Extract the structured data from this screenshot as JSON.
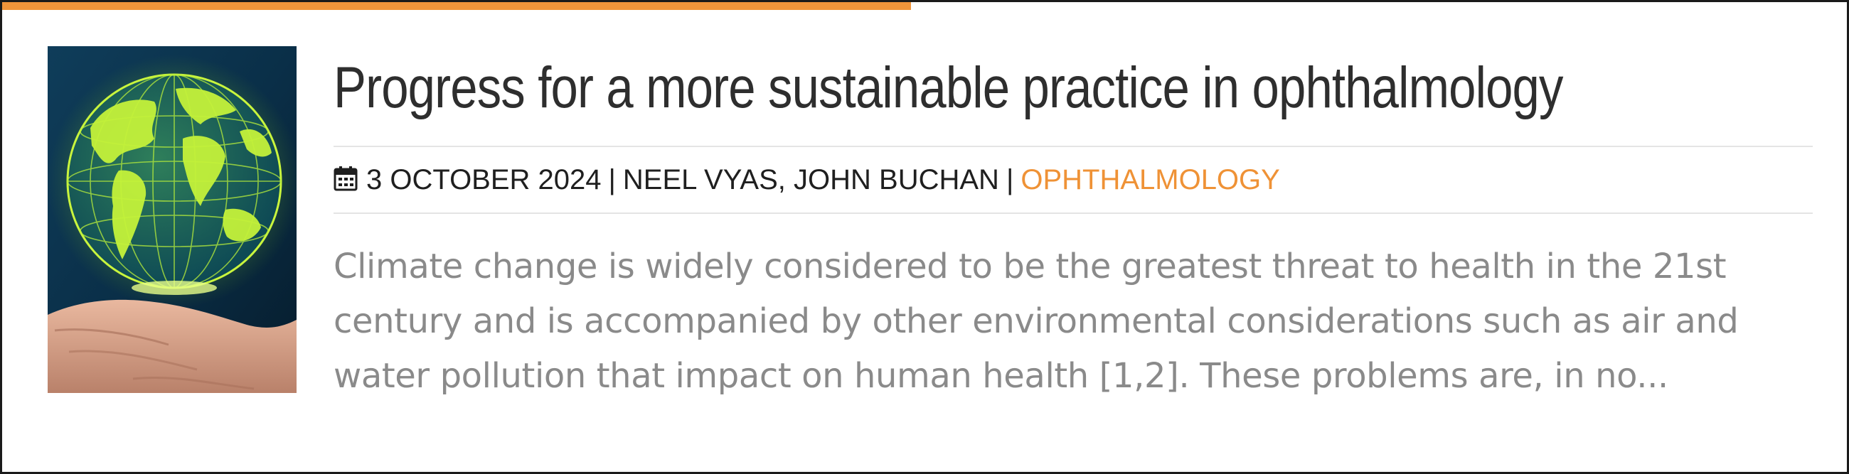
{
  "article": {
    "title": "Progress for a more sustainable practice in ophthalmology",
    "image_alt": "Glowing green wireframe globe hovering above an open hand",
    "meta": {
      "date_icon": "calendar-icon",
      "date": "3 OCTOBER 2024",
      "separator": "|",
      "authors": "NEEL VYAS, JOHN BUCHAN",
      "category": "OPHTHALMOLOGY"
    },
    "excerpt": "Climate change is widely considered to be the greatest threat to health in the 21st century and is accompanied by other environmental considerations such as air and water pollution that impact on human health [1,2]. These problems are, in no..."
  },
  "colors": {
    "accent": "#f0953a",
    "title": "#2e2e2e",
    "meta_text": "#1f1f1f",
    "excerpt_text": "#8a8a8a",
    "divider": "#e4e4e4",
    "border": "#1a1a1a"
  }
}
